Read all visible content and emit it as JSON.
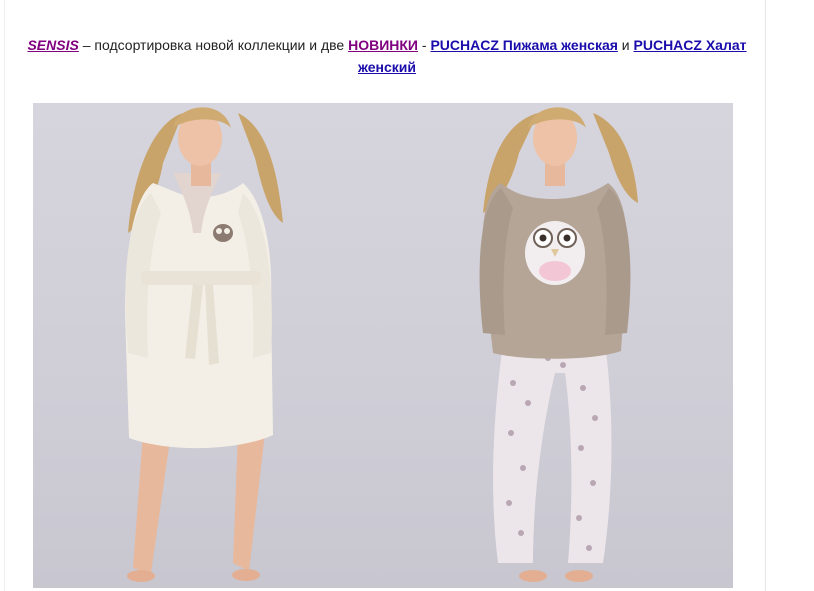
{
  "intro": {
    "brand_link": "SENSIS",
    "text_1": " – подсортировка новой коллекции и две ",
    "novelty_link": "НОВИНКИ",
    "separator": " - ",
    "pajama_link": "PUCHACZ Пижама женская",
    "conjunction": " и ",
    "robe_link": "PUCHACZ Халат женский"
  },
  "colors": {
    "link": "#1a0dab",
    "visited_link": "#800080",
    "photo_background": "#d4d2da",
    "robe": "#f3efe6",
    "sweater": "#b4a597",
    "pants_print": "#ece6ea"
  },
  "photos": [
    {
      "subject": "model in white fleece robe with owl patch"
    },
    {
      "subject": "model in beige owl sweater and white printed pajama pants"
    }
  ]
}
